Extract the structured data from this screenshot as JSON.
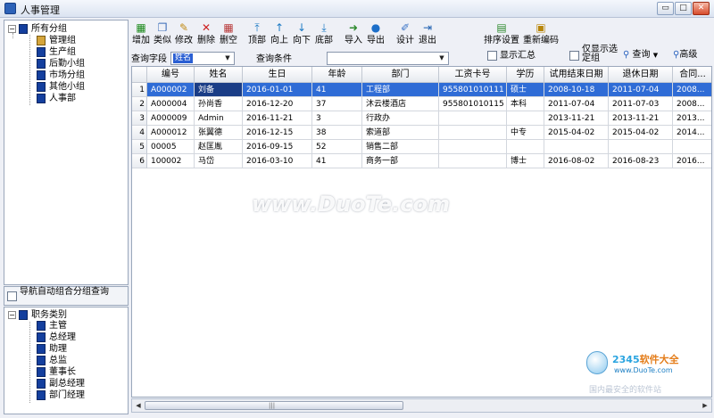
{
  "window": {
    "title": "人事管理",
    "buttons": [
      "▭",
      "□",
      "✕"
    ]
  },
  "tree_top": {
    "root": "所有分组",
    "items": [
      "管理组",
      "生产组",
      "后勤小组",
      "市场分组",
      "其他小组",
      "人事部"
    ]
  },
  "nav_auto_group": {
    "label": "导航自动组合分组查询"
  },
  "tree_bottom": {
    "root": "职务类别",
    "items": [
      "主管",
      "总经理",
      "助理",
      "总监",
      "董事长",
      "副总经理",
      "部门经理"
    ]
  },
  "toolbar": {
    "add": "增加",
    "similar": "类似",
    "modify": "修改",
    "delete": "删除",
    "clear": "删空",
    "top": "顶部",
    "up": "向上",
    "down": "向下",
    "bottom": "底部",
    "import": "导入",
    "export": "导出",
    "design": "设计",
    "exit": "退出",
    "sort_settings": "排序设置",
    "recode": "重新编码"
  },
  "query": {
    "field_label": "查询字段",
    "field_value": "姓名",
    "condition_label": "查询条件",
    "condition_value": "",
    "show_summary": "显示汇总",
    "only_selected": "仅显示选定组",
    "search": "查询",
    "advanced": "高级"
  },
  "table": {
    "columns": [
      "编号",
      "姓名",
      "生日",
      "年龄",
      "部门",
      "工资卡号",
      "学历",
      "试用结束日期",
      "退休日期",
      "合同..."
    ],
    "rows": [
      [
        "1",
        "A000002",
        "刘备",
        "2016-01-01",
        "41",
        "工程部",
        "955801010111",
        "硕士",
        "2008-10-18",
        "2011-07-04",
        "2008..."
      ],
      [
        "2",
        "A000004",
        "孙尚香",
        "2016-12-20",
        "37",
        "沐云楼酒店",
        "955801010115",
        "本科",
        "2011-07-04",
        "2011-07-03",
        "2008..."
      ],
      [
        "3",
        "A000009",
        "Admin",
        "2016-11-21",
        "3",
        "行政办",
        "",
        "",
        "2013-11-21",
        "2013-11-21",
        "2013..."
      ],
      [
        "4",
        "A000012",
        "张翼德",
        "2016-12-15",
        "38",
        "索道部",
        "",
        "中专",
        "2015-04-02",
        "2015-04-02",
        "2014..."
      ],
      [
        "5",
        "00005",
        "赵匡胤",
        "2016-09-15",
        "52",
        "销售二部",
        "",
        "",
        "",
        "",
        ""
      ],
      [
        "6",
        "100002",
        "马岱",
        "2016-03-10",
        "41",
        "商务一部",
        "",
        "博士",
        "2016-08-02",
        "2016-08-23",
        "2016..."
      ]
    ],
    "selected_row": 0
  },
  "watermark": "www.DuoTe.com",
  "logo": {
    "brand_num": "2345",
    "brand_text": "软件大全",
    "url": "www.DuoTe.com",
    "tagline": "国内最安全的软件站"
  }
}
